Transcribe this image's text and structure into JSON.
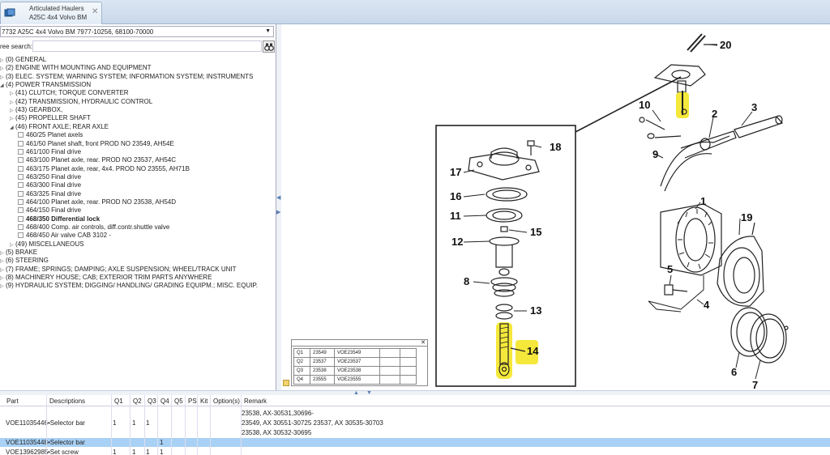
{
  "tab": {
    "title_line1": "Articulated Haulers",
    "title_line2": "A25C 4x4 Volvo BM",
    "close_glyph": "✕"
  },
  "model_select": {
    "value": "7732 A25C 4x4 Volvo BM 7977-10256, 68100-70000"
  },
  "search": {
    "label": "ree search:",
    "value": ""
  },
  "tree": [
    {
      "label": "(0) GENERAL",
      "exp": "▷",
      "level": 0
    },
    {
      "label": "(2) ENGINE WITH MOUNTING AND EQUIPMENT",
      "exp": "▷",
      "level": 0
    },
    {
      "label": "(3) ELEC. SYSTEM; WARNING SYSTEM; INFORMATION  SYSTEM; INSTRUMENTS",
      "exp": "▷",
      "level": 0
    },
    {
      "label": "(4) POWER TRANSMISSION",
      "exp": "◢",
      "level": 0
    },
    {
      "label": "(41) CLUTCH; TORQUE CONVERTER",
      "exp": "▷",
      "level": 1
    },
    {
      "label": "(42) TRANSMISSION, HYDRAULIC CONTROL",
      "exp": "▷",
      "level": 1
    },
    {
      "label": "(43) GEARBOX,",
      "exp": "▷",
      "level": 1
    },
    {
      "label": "(45) PROPELLER SHAFT",
      "exp": "▷",
      "level": 1
    },
    {
      "label": "(46) FRONT AXLE; REAR AXLE",
      "exp": "◢",
      "level": 1
    },
    {
      "label": "460/25 Planet axels",
      "exp": "",
      "level": 2,
      "doc": true
    },
    {
      "label": "461/50 Planet shaft, front PROD NO 23549, AH54E",
      "exp": "",
      "level": 2,
      "doc": true
    },
    {
      "label": "461/100 Final drive",
      "exp": "",
      "level": 2,
      "doc": true
    },
    {
      "label": "463/100 Planet axle, rear. PROD NO 23537, AH54C",
      "exp": "",
      "level": 2,
      "doc": true
    },
    {
      "label": "463/175 Planet axle, rear, 4x4. PROD NO 23555, AH71B",
      "exp": "",
      "level": 2,
      "doc": true
    },
    {
      "label": "463/250 Final drive",
      "exp": "",
      "level": 2,
      "doc": true
    },
    {
      "label": "463/300 Final drive",
      "exp": "",
      "level": 2,
      "doc": true
    },
    {
      "label": "463/325 Final drive",
      "exp": "",
      "level": 2,
      "doc": true
    },
    {
      "label": "464/100 Planet axle, rear. PROD NO 23538, AH54D",
      "exp": "",
      "level": 2,
      "doc": true
    },
    {
      "label": "464/150 Final drive",
      "exp": "",
      "level": 2,
      "doc": true
    },
    {
      "label": "468/350 Differential lock",
      "exp": "",
      "level": 2,
      "doc": true,
      "bold": true
    },
    {
      "label": "468/400 Comp. air controls, diff.contr.shuttle valve",
      "exp": "",
      "level": 2,
      "doc": true
    },
    {
      "label": "468/450 Air valve CAB 3102 -",
      "exp": "",
      "level": 2,
      "doc": true
    },
    {
      "label": "(49) MISCELLANEOUS",
      "exp": "▷",
      "level": 1
    },
    {
      "label": "(5) BRAKE",
      "exp": "▷",
      "level": 0
    },
    {
      "label": "(6) STEERING",
      "exp": "▷",
      "level": 0
    },
    {
      "label": "(7) FRAME; SPRINGS; DAMPING; AXLE SUSPENSION;  WHEEL/TRACK UNIT",
      "exp": "▷",
      "level": 0
    },
    {
      "label": "(8) MACHINERY HOUSE; CAB; EXTERIOR TRIM PARTS  ANYWHERE",
      "exp": "▷",
      "level": 0
    },
    {
      "label": "(9) HYDRAULIC SYSTEM; DIGGING/ HANDLING/  GRADING EQUIPM.; MISC. EQUIP.",
      "exp": "▷",
      "level": 0
    }
  ],
  "diagram": {
    "callouts": [
      "20",
      "10",
      "2",
      "3",
      "9",
      "18",
      "17",
      "16",
      "11",
      "12",
      "15",
      "1",
      "19",
      "8",
      "5",
      "13",
      "4",
      "14",
      "6",
      "7"
    ],
    "highlight_color": "#f5e83a"
  },
  "mini_table": {
    "rows": [
      [
        "Q1",
        "23549",
        "VOE23549",
        "",
        ""
      ],
      [
        "Q2",
        "23537",
        "VOE23537",
        "",
        ""
      ],
      [
        "Q3",
        "23538",
        "VOE23538",
        "",
        ""
      ],
      [
        "Q4",
        "23555",
        "VOE23555",
        "",
        ""
      ]
    ]
  },
  "grid": {
    "columns": [
      "Part",
      "Descriptions",
      "Q1",
      "Q2",
      "Q3",
      "Q4",
      "Q5",
      "PS",
      "Kit",
      "Option(s)",
      "Remark"
    ],
    "rows": [
      {
        "part": "",
        "desc": "",
        "q1": "",
        "q2": "",
        "q3": "",
        "q4": "",
        "remark": "23538, AX-30531,30696-"
      },
      {
        "part": "VOE11035446",
        "desc": "•Selector bar",
        "q1": "1",
        "q2": "1",
        "q3": "1",
        "q4": "",
        "remark": "23549, AX 30551-30725 23537, AX 30535-30703"
      },
      {
        "part": "",
        "desc": "",
        "q1": "",
        "q2": "",
        "q3": "",
        "q4": "",
        "remark": "23538, AX 30532-30695"
      },
      {
        "part": "VOE11035448",
        "desc": "•Selector bar",
        "q1": "",
        "q2": "",
        "q3": "",
        "q4": "1",
        "remark": ""
      },
      {
        "part": "VOE13962985",
        "desc": "•Set screw",
        "q1": "1",
        "q2": "1",
        "q3": "1",
        "q4": "1",
        "remark": ""
      }
    ]
  }
}
